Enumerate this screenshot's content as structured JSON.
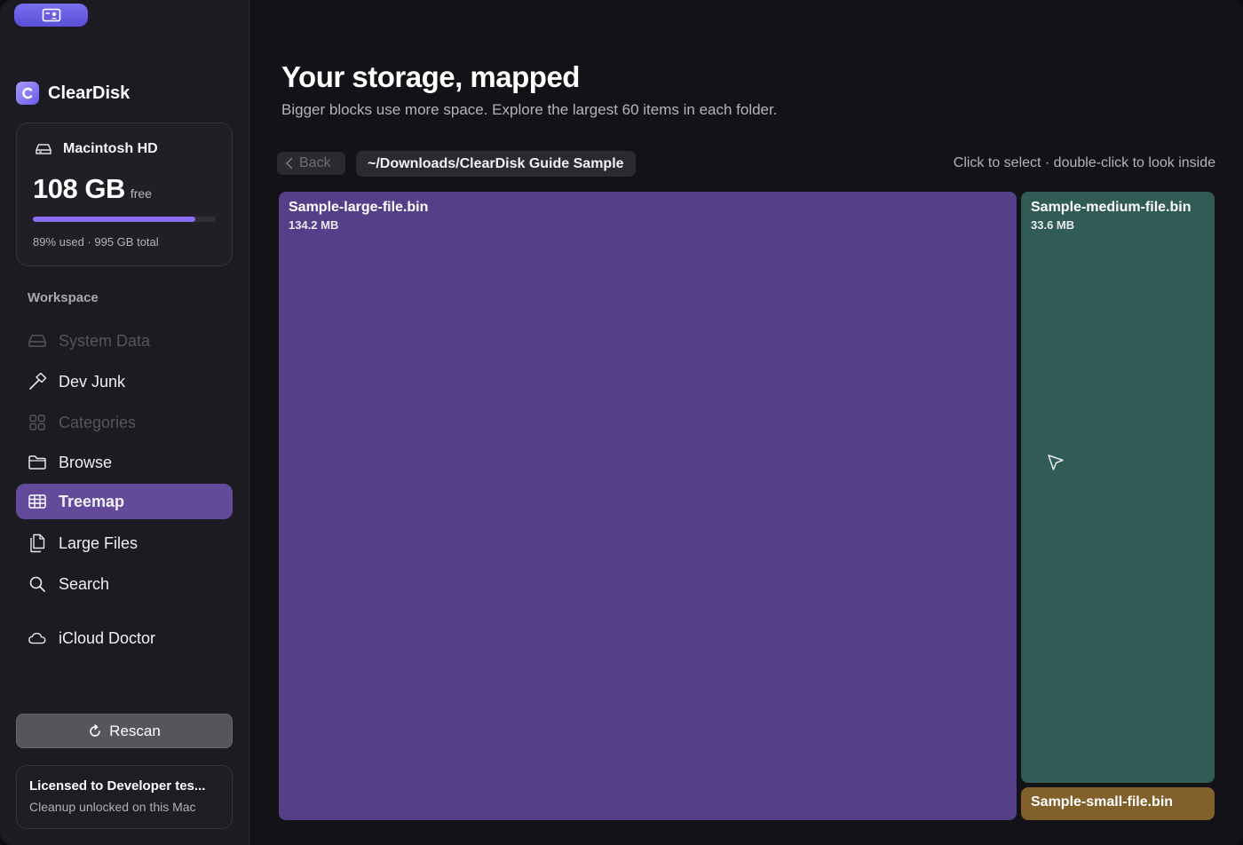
{
  "app": {
    "name": "ClearDisk",
    "top_button_icon": "person-card-icon"
  },
  "disk": {
    "name": "Macintosh HD",
    "free_value": "108 GB",
    "free_unit": "free",
    "used_fraction": 0.89,
    "meta": "89% used · 995 GB total"
  },
  "sidebar": {
    "section_label": "Workspace",
    "items": [
      {
        "label": "System Data",
        "icon": "drive-icon",
        "disabled": true
      },
      {
        "label": "Dev Junk",
        "icon": "hammer-icon",
        "disabled": false
      },
      {
        "label": "Categories",
        "icon": "grid-icon",
        "disabled": true
      },
      {
        "label": "Browse",
        "icon": "folder-icon",
        "disabled": false
      },
      {
        "label": "Treemap",
        "icon": "table-icon",
        "active": true
      },
      {
        "label": "Large Files",
        "icon": "documents-icon",
        "disabled": false
      },
      {
        "label": "Search",
        "icon": "magnifier-icon",
        "disabled": false
      },
      {
        "label": "iCloud Doctor",
        "icon": "cloud-icon",
        "disabled": false
      }
    ],
    "rescan_label": "Rescan",
    "license_title": "Licensed to Developer tes...",
    "license_sub": "Cleanup unlocked on this Mac"
  },
  "main": {
    "title": "Your storage, mapped",
    "subtitle": "Bigger blocks use more space. Explore the largest 60 items in each folder.",
    "back_label": "Back",
    "path": "~/Downloads/ClearDisk Guide Sample",
    "hint": "Click to select · double-click to look inside"
  },
  "treemap": {
    "tiles": [
      {
        "name": "Sample-large-file.bin",
        "size": "134.2 MB",
        "color": "#553f89"
      },
      {
        "name": "Sample-medium-file.bin",
        "size": "33.6 MB",
        "color": "#305c55"
      },
      {
        "name": "Sample-small-file.bin",
        "size": "",
        "color": "#81602c"
      }
    ]
  },
  "colors": {
    "accent": "#634a9b",
    "bar": "#8a6df0"
  }
}
